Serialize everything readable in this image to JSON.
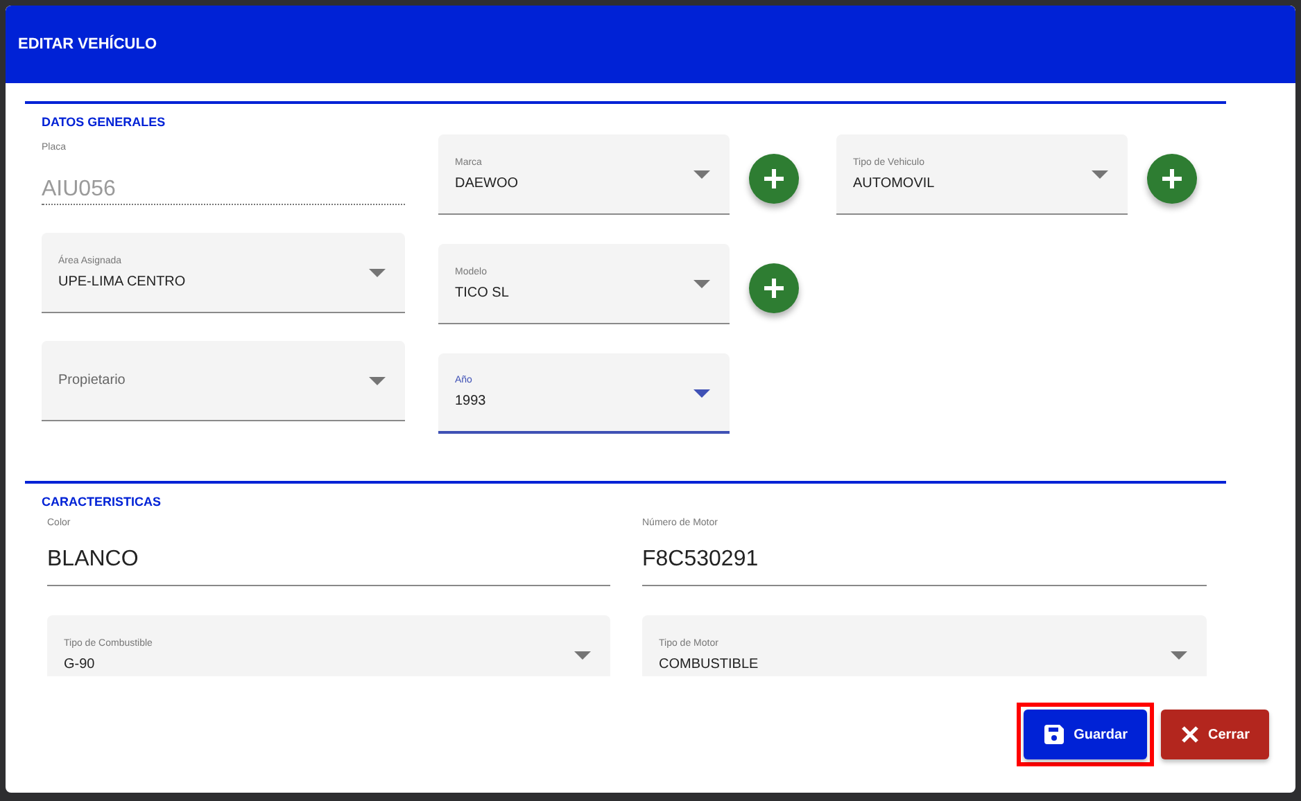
{
  "dialog": {
    "title": "EDITAR VEHÍCULO"
  },
  "datos_generales": {
    "title": "DATOS GENERALES",
    "columns": [
      {
        "fields": [
          {
            "kind": "readonly",
            "label": "Placa",
            "value": "AIU056",
            "disabled": true
          },
          {
            "kind": "select",
            "label": "Área Asignada",
            "value": "UPE-LIMA CENTRO",
            "focused": false,
            "add_button": false
          },
          {
            "kind": "select",
            "placeholder": "Propietario",
            "focused": false,
            "add_button": false
          }
        ]
      },
      {
        "fields": [
          {
            "kind": "select",
            "label": "Marca",
            "value": "DAEWOO",
            "focused": false,
            "add_button": true
          },
          {
            "kind": "select",
            "label": "Modelo",
            "value": "TICO SL",
            "focused": false,
            "add_button": true
          },
          {
            "kind": "select",
            "label": "Año",
            "value": "1993",
            "focused": true,
            "add_button": false
          }
        ]
      },
      {
        "fields": [
          {
            "kind": "select",
            "label": "Tipo de Vehiculo",
            "value": "AUTOMOVIL",
            "focused": false,
            "add_button": true
          }
        ]
      }
    ]
  },
  "caracteristicas": {
    "title": "CARACTERISTICAS",
    "fields": [
      {
        "kind": "text",
        "label": "Color",
        "value": "BLANCO"
      },
      {
        "kind": "text",
        "label": "Número de Motor",
        "value": "F8C530291"
      },
      {
        "kind": "select",
        "label": "Tipo de Combustible",
        "value": "G-90",
        "focused": false,
        "add_button": false
      },
      {
        "kind": "select",
        "label": "Tipo de Motor",
        "value": "COMBUSTIBLE",
        "focused": false,
        "add_button": false
      }
    ]
  },
  "buttons": [
    {
      "label": "Guardar",
      "kind": "primary",
      "highlighted": true
    },
    {
      "label": "Cerrar",
      "kind": "danger"
    }
  ]
}
